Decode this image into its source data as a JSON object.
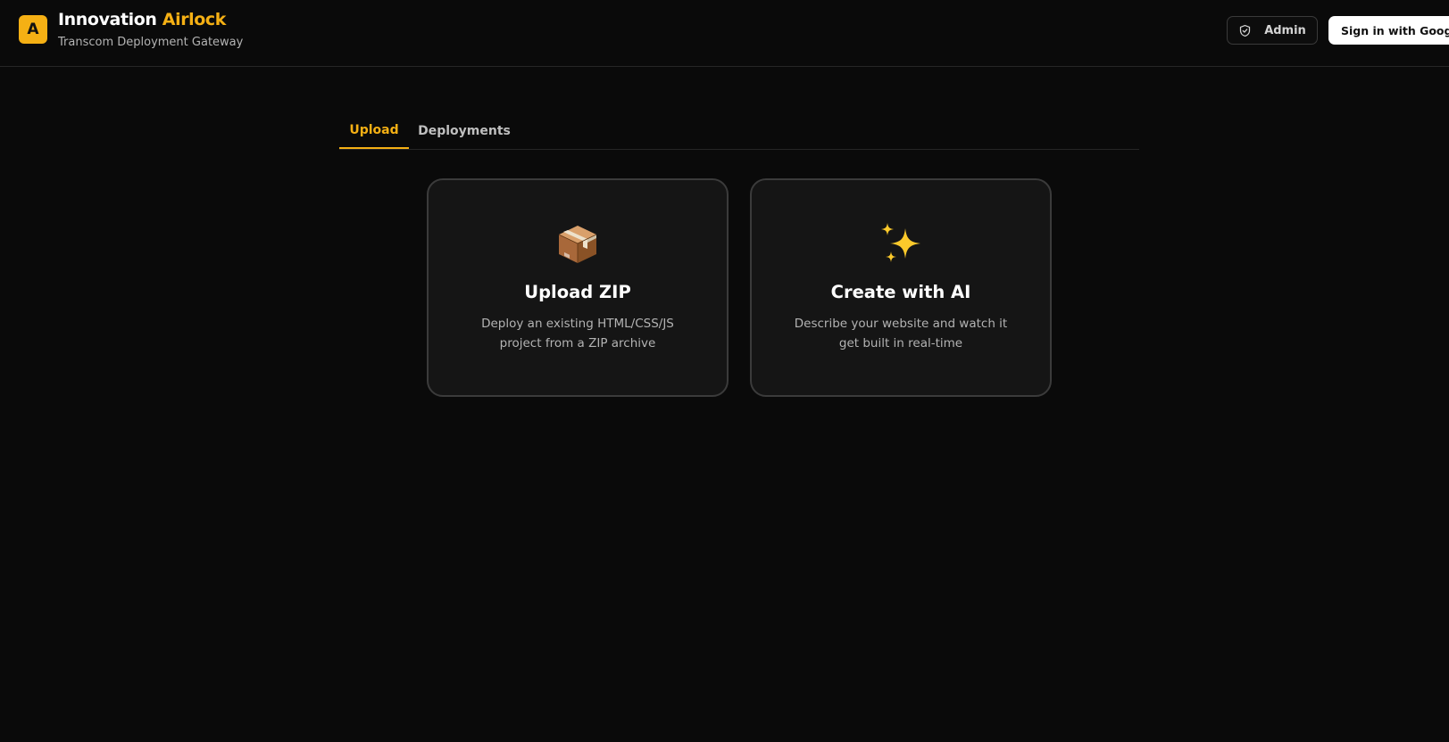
{
  "header": {
    "logo_letter": "A",
    "brand_primary": "Innovation",
    "brand_accent": "Airlock",
    "subtitle": "Transcom Deployment Gateway",
    "admin_label": "Admin",
    "admin_icon": "shield-check-icon",
    "signin_label": "Sign in with Google"
  },
  "tabs": [
    {
      "label": "Upload",
      "active": true
    },
    {
      "label": "Deployments",
      "active": false
    }
  ],
  "cards": [
    {
      "icon": "package-icon",
      "title": "Upload ZIP",
      "description": "Deploy an existing HTML/CSS/JS project from a ZIP archive"
    },
    {
      "icon": "sparkles-icon",
      "title": "Create with AI",
      "description": "Describe your website and watch it get built in real-time"
    }
  ],
  "colors": {
    "accent": "#f5b014",
    "background": "#0a0a0a",
    "card_background": "#151515",
    "card_border": "#3b3b3b"
  }
}
